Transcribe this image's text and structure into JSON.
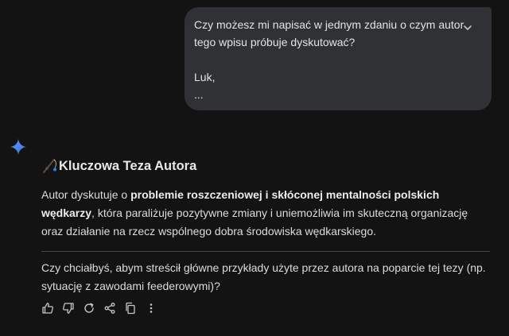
{
  "user_message": {
    "line1": "Czy możesz mi napisać w jednym zdaniu o czym autor",
    "line2": "tego wpisu próbuje dyskutować?",
    "line3": "Luk,",
    "line4": "..."
  },
  "response": {
    "heading": "Kluczowa Teza Autora",
    "heading_emoji": "fishing-pole-emoji",
    "para_before": "Autor dyskutuje o ",
    "para_bold": "problemie roszczeniowej i skłóconej mentalności polskich wędkarzy",
    "para_after": ", która paraliżuje pozytywne zmiany i uniemożliwia im skuteczną organizację oraz działanie na rzecz wspólnego dobra środowiska wędkarskiego.",
    "question": "Czy chciałbyś, abym streścił główne przykłady użyte przez autora na poparcie tej tezy (np. sytuację z zawodami feederowymi)?"
  },
  "actions": [
    "thumb-up-icon",
    "thumb-down-icon",
    "regenerate-icon",
    "share-icon",
    "copy-icon",
    "more-vert-icon"
  ],
  "colors": {
    "background": "#131314",
    "bubble": "#303134",
    "gemini_blue": "#4b8bf5",
    "text": "#e3e3e3",
    "divider": "#444746"
  }
}
